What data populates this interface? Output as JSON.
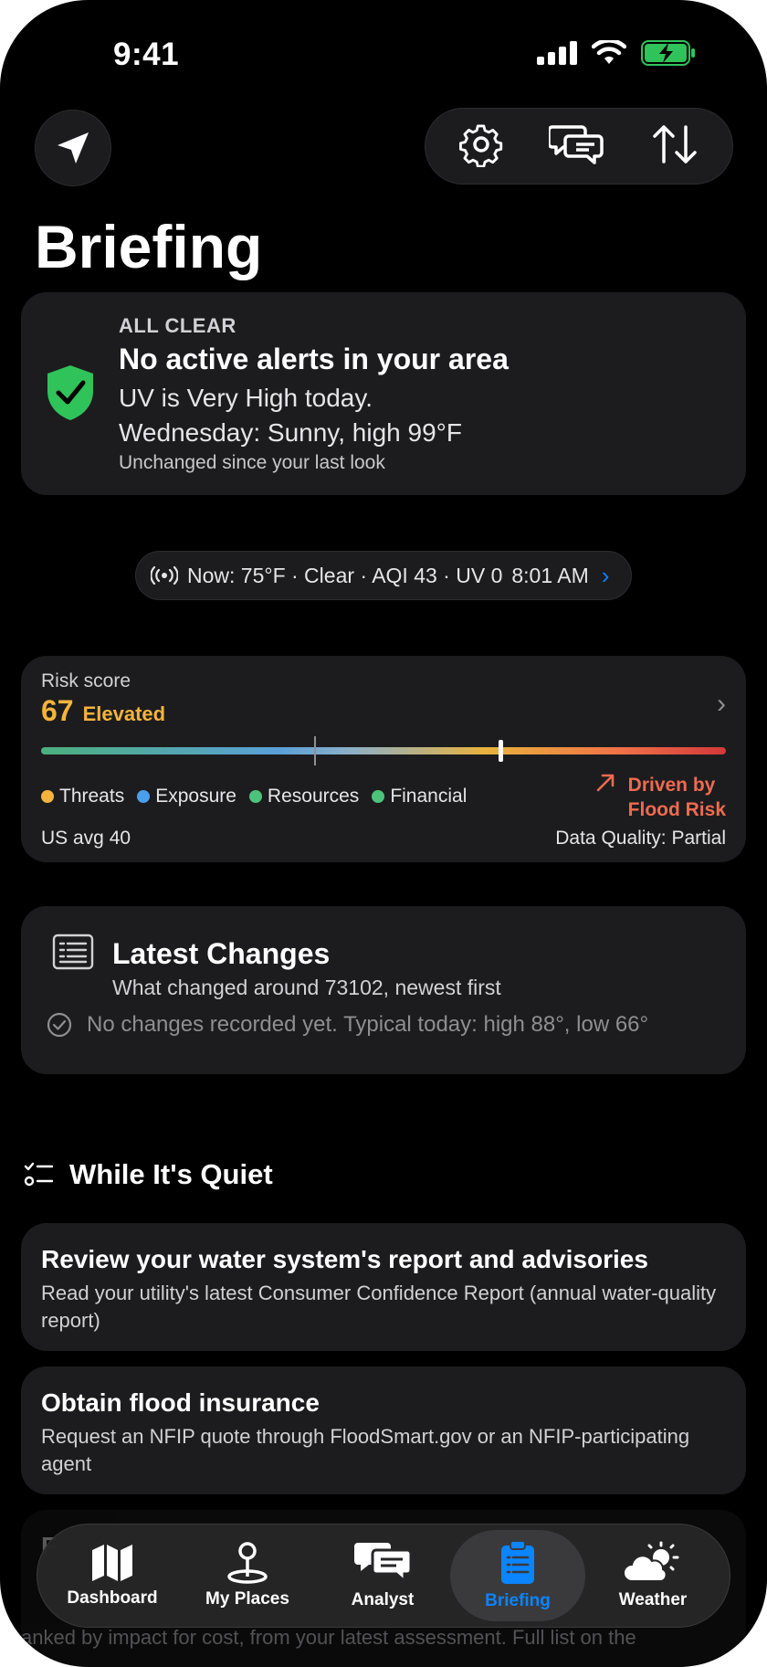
{
  "status_bar": {
    "time": "9:41"
  },
  "header": {
    "title": "Briefing"
  },
  "alert": {
    "kicker": "ALL CLEAR",
    "title": "No active alerts in your area",
    "line1": "UV is Very High today.",
    "line2": "Wednesday: Sunny, high 99°F",
    "footnote": "Unchanged since your last look"
  },
  "now": {
    "text": "Now: 75°F · Clear · AQI 43 · UV 0",
    "time": "8:01 AM"
  },
  "risk": {
    "label": "Risk score",
    "score": "67",
    "level": "Elevated",
    "score_fraction": 0.67,
    "avg_fraction": 0.4,
    "legend": [
      {
        "label": "Threats",
        "color": "#f5b33b"
      },
      {
        "label": "Exposure",
        "color": "#4a9eee"
      },
      {
        "label": "Resources",
        "color": "#4cc37a"
      },
      {
        "label": "Financial",
        "color": "#4cc37a"
      }
    ],
    "driven_line1": "Driven by",
    "driven_line2": "Flood Risk",
    "us_avg": "US avg 40",
    "data_quality": "Data Quality: Partial"
  },
  "changes": {
    "title": "Latest Changes",
    "subtitle": "What changed around 73102, newest first",
    "empty": "No changes recorded yet. Typical today: high 88°, low 66°"
  },
  "quiet": {
    "heading": "While It's Quiet",
    "tasks": [
      {
        "title": "Review your water system's report and advisories",
        "desc": "Read your utility's latest Consumer Confidence Report (annual water-quality report)"
      },
      {
        "title": "Obtain flood insurance",
        "desc": "Request an NFIP quote through FloodSmart.gov or an NFIP-participating agent"
      },
      {
        "title": "F",
        "desc": ""
      }
    ],
    "under_text": "anked by impact for cost, from your latest assessment. Full list on the"
  },
  "tabs": [
    {
      "label": "Dashboard",
      "icon": "map-icon"
    },
    {
      "label": "My Places",
      "icon": "pin-icon"
    },
    {
      "label": "Analyst",
      "icon": "chat-icon"
    },
    {
      "label": "Briefing",
      "icon": "clipboard-icon",
      "active": true
    },
    {
      "label": "Weather",
      "icon": "sun-cloud-icon"
    }
  ],
  "colors": {
    "accent": "#0a84ff",
    "warning": "#f5b33b",
    "danger": "#ef6a4f",
    "safe": "#30c35a"
  }
}
